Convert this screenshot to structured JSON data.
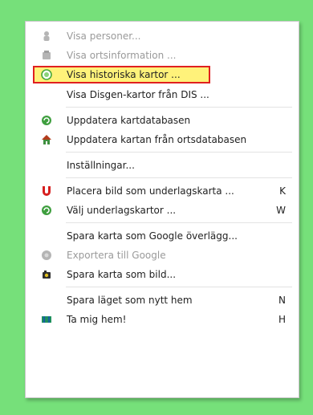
{
  "menu": {
    "items": [
      {
        "label": "Visa personer...",
        "icon": "person-icon",
        "disabled": true,
        "shortcut": ""
      },
      {
        "label": "Visa ortsinformation ...",
        "icon": "info-icon",
        "disabled": true,
        "shortcut": ""
      },
      {
        "label": "Visa historiska kartor ...",
        "icon": "historic-map-icon",
        "disabled": false,
        "highlighted": true,
        "shortcut": ""
      },
      {
        "label": "Visa Disgen-kartor från DIS ...",
        "icon": "",
        "disabled": false,
        "shortcut": ""
      },
      {
        "label": "Uppdatera kartdatabasen",
        "icon": "map-database-refresh-icon",
        "disabled": false,
        "shortcut": ""
      },
      {
        "label": "Uppdatera kartan från ortsdatabasen",
        "icon": "house-refresh-icon",
        "disabled": false,
        "shortcut": ""
      },
      {
        "label": "Inställningar...",
        "icon": "",
        "disabled": false,
        "shortcut": ""
      },
      {
        "label": "Placera bild som underlagskarta ...",
        "icon": "magnet-icon",
        "disabled": false,
        "shortcut": "K"
      },
      {
        "label": "Välj underlagskartor ...",
        "icon": "layers-icon",
        "disabled": false,
        "shortcut": "W"
      },
      {
        "label": "Spara karta som Google överlägg...",
        "icon": "",
        "disabled": false,
        "shortcut": ""
      },
      {
        "label": "Exportera till Google",
        "icon": "google-export-icon",
        "disabled": true,
        "shortcut": ""
      },
      {
        "label": "Spara karta som bild...",
        "icon": "camera-icon",
        "disabled": false,
        "shortcut": ""
      },
      {
        "label": "Spara läget som nytt hem",
        "icon": "",
        "disabled": false,
        "shortcut": "N"
      },
      {
        "label": "Ta mig hem!",
        "icon": "home-flag-icon",
        "disabled": false,
        "shortcut": "H"
      }
    ]
  },
  "colors": {
    "background": "#76e07a",
    "highlight_fill": "#fff27a",
    "highlight_border": "#e02020",
    "magnet_red": "#d61f1f"
  }
}
